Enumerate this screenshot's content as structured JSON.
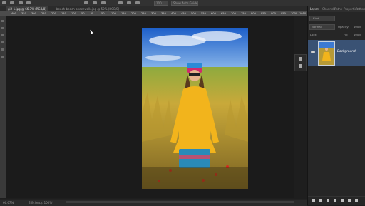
{
  "options_bar": {
    "font_size": "100",
    "mode_label": "Show Auto Guide"
  },
  "tabs": [
    {
      "label": "girl 1.jpg @ 66.7% (RGB/8)",
      "active": true
    },
    {
      "label": "beach-beach-beachwalk.jpg @ 50% (RGB/8)",
      "active": false
    }
  ],
  "ruler": {
    "ticks": [
      "400",
      "350",
      "300",
      "250",
      "200",
      "150",
      "100",
      "50",
      "0",
      "50",
      "100",
      "150",
      "200",
      "250",
      "300",
      "350",
      "400",
      "450",
      "500",
      "550",
      "600",
      "650",
      "700",
      "750",
      "800",
      "850",
      "900",
      "950",
      "1000",
      "1050"
    ]
  },
  "status": {
    "zoom": "66.67%",
    "info": "Efficiency: 100%*"
  },
  "panel": {
    "tabs": [
      "Layers",
      "Channels",
      "Paths",
      "Properties",
      "Patterns"
    ],
    "search_placeholder": "Kind",
    "blend_mode": "Normal",
    "opacity_label": "Opacity:",
    "opacity_value": "100%",
    "lock_label": "Lock:",
    "fill_label": "Fill:",
    "fill_value": "100%",
    "layer_name": "Background"
  },
  "colors": {
    "panel_bg": "#262626",
    "selected_layer": "#3a5274",
    "canvas_bg": "#1b1b1b"
  }
}
